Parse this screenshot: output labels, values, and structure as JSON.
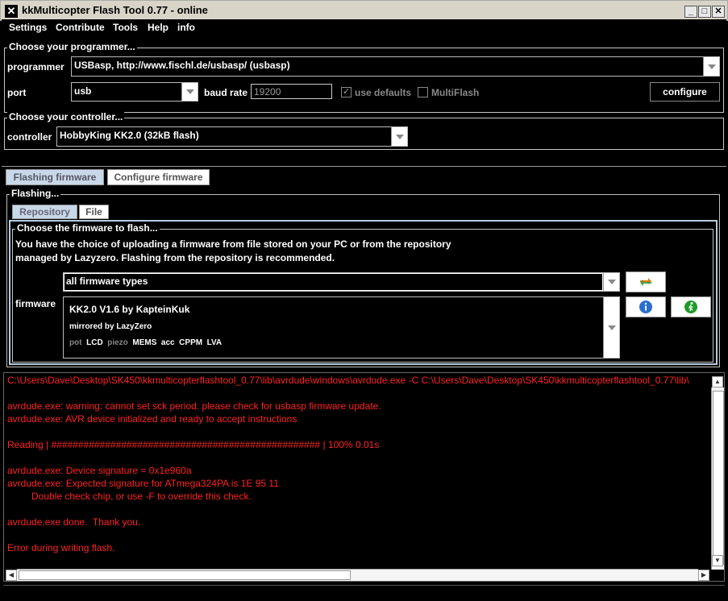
{
  "window": {
    "title": "kkMulticopter Flash Tool 0.77 - online"
  },
  "menu": [
    "Settings",
    "Contribute",
    "Tools",
    "Help",
    "info"
  ],
  "programmer_panel": {
    "legend": "Choose your programmer...",
    "programmer_label": "programmer",
    "programmer_value": "USBasp, http://www.fischl.de/usbasp/ (usbasp)",
    "port_label": "port",
    "port_value": "usb",
    "baud_label": "baud rate",
    "baud_value": "19200",
    "use_defaults_label": "use defaults",
    "multiflash_label": "MultiFlash",
    "configure_label": "configure"
  },
  "controller_panel": {
    "legend": "Choose your controller...",
    "controller_label": "controller",
    "controller_value": "HobbyKing KK2.0 (32kB flash)"
  },
  "main_tabs": [
    "Flashing firmware",
    "Configure firmware"
  ],
  "flashing_panel": {
    "legend": "Flashing...",
    "sub_tabs": [
      "Repository",
      "File"
    ],
    "choose_legend": "Choose the firmware to flash...",
    "description_line1": "You have the choice of uploading a firmware from file stored on your PC or from the repository",
    "description_line2": "managed by Lazyzero. Flashing from the repository is recommended.",
    "filter_value": "all firmware types",
    "firmware_label": "firmware",
    "firmware_name": "KK2.0 V1.6  by KapteinKuk",
    "firmware_mirror": "mirrored by LazyZero",
    "features": [
      {
        "label": "pot",
        "active": false
      },
      {
        "label": "LCD",
        "active": true
      },
      {
        "label": "piezo",
        "active": false
      },
      {
        "label": "MEMS",
        "active": true
      },
      {
        "label": "acc",
        "active": true
      },
      {
        "label": "CPPM",
        "active": true
      },
      {
        "label": "LVA",
        "active": true
      }
    ]
  },
  "console": {
    "lines": [
      "C:\\Users\\Dave\\Desktop\\SK450\\kkmulticopterflashtool_0.77\\lib\\avrdude\\windows\\avrdude.exe -C C:\\Users\\Dave\\Desktop\\SK450\\kkmulticopterflashtool_0.77\\lib\\",
      "",
      "avrdude.exe: warning: cannot set sck period. please check for usbasp firmware update.",
      "avrdude.exe: AVR device initialized and ready to accept instructions",
      "",
      "Reading | ################################################## | 100% 0.01s",
      "",
      "avrdude.exe: Device signature = 0x1e960a",
      "avrdude.exe: Expected signature for ATmega324PA is 1E 95 11",
      "         Double check chip, or use -F to override this check.",
      "",
      "avrdude.exe done.  Thank you.",
      "",
      "Error during writing flash."
    ]
  },
  "colors": {
    "console_text": "#ff2222",
    "background": "#000000",
    "panel_border": "#c8c8c8"
  }
}
